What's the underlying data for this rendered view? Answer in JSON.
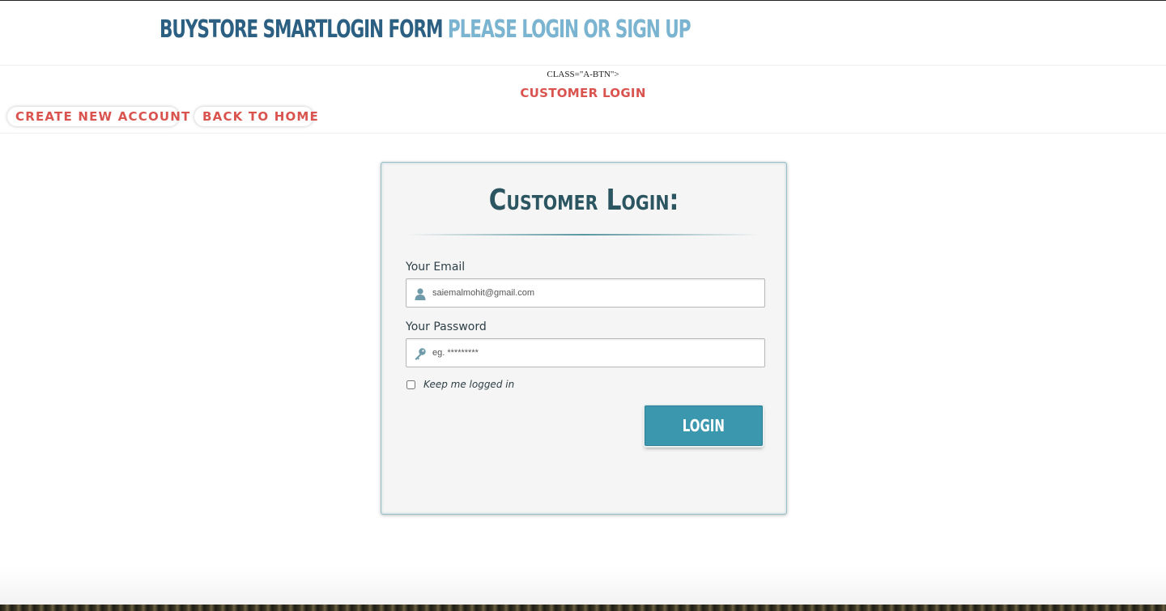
{
  "header": {
    "brand": "BUYSTORE SMARTLOGIN FORM",
    "subtitle": "PLEASE LOGIN OR SIGN UP"
  },
  "nav": {
    "stray_text": "CLASS=\"A-BTN\">",
    "title": "CUSTOMER LOGIN",
    "create_account_label": "CREATE NEW ACCOUNT",
    "back_home_label": "BACK TO HOME"
  },
  "login_form": {
    "title": "Customer Login:",
    "email": {
      "label": "Your Email",
      "value": "saiemalmohit@gmail.com",
      "icon": "user-icon"
    },
    "password": {
      "label": "Your Password",
      "placeholder": "eg. *********",
      "icon": "key-icon"
    },
    "remember_label": "Keep me logged in",
    "submit_label": "LOGIN"
  },
  "colors": {
    "brand": "#2c6083",
    "subtitle": "#7ab4d0",
    "accent_red": "#d9534f",
    "button": "#3a97ae"
  }
}
